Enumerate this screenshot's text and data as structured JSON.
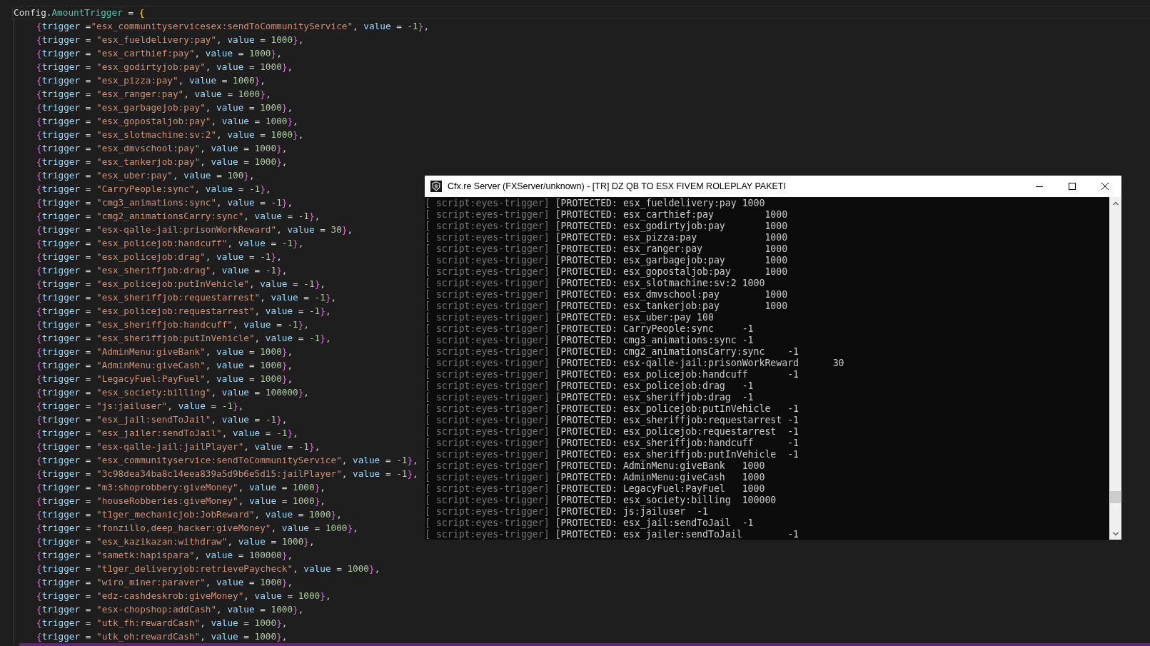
{
  "editor": {
    "header": "Config.AmountTrigger = {",
    "entries": [
      "{trigger =\"esx_communityservicesex:sendToCommunityService\", value = -1},",
      "{trigger = \"esx_fueldelivery:pay\", value = 1000},",
      "{trigger = \"esx_carthief:pay\", value = 1000},",
      "{trigger = \"esx_godirtyjob:pay\", value = 1000},",
      "{trigger = \"esx_pizza:pay\", value = 1000},",
      "{trigger = \"esx_ranger:pay\", value = 1000},",
      "{trigger = \"esx_garbagejob:pay\", value = 1000},",
      "{trigger = \"esx_gopostaljob:pay\", value = 1000},",
      "{trigger = \"esx_slotmachine:sv:2\", value = 1000},",
      "{trigger = \"esx_dmvschool:pay\", value = 1000},",
      "{trigger = \"esx_tankerjob:pay\", value = 1000},",
      "{trigger = \"esx_uber:pay\", value = 100},",
      "{trigger = \"CarryPeople:sync\", value = -1},",
      "{trigger = \"cmg3_animations:sync\", value = -1},",
      "{trigger = \"cmg2_animationsCarry:sync\", value = -1},",
      "{trigger = \"esx-qalle-jail:prisonWorkReward\", value = 30},",
      "{trigger = \"esx_policejob:handcuff\", value = -1},",
      "{trigger = \"esx_policejob:drag\", value = -1},",
      "{trigger = \"esx_sheriffjob:drag\", value = -1},",
      "{trigger = \"esx_policejob:putInVehicle\", value = -1},",
      "{trigger = \"esx_sheriffjob:requestarrest\", value = -1},",
      "{trigger = \"esx_policejob:requestarrest\", value = -1},",
      "{trigger = \"esx_sheriffjob:handcuff\", value = -1},",
      "{trigger = \"esx_sheriffjob:putInVehicle\", value = -1},",
      "{trigger = \"AdminMenu:giveBank\", value = 1000},",
      "{trigger = \"AdminMenu:giveCash\", value = 1000},",
      "{trigger = \"LegacyFuel:PayFuel\", value = 1000},",
      "{trigger = \"esx_society:billing\", value = 100000},",
      "{trigger = \"js:jailuser\", value = -1},",
      "{trigger = \"esx_jail:sendToJail\", value = -1},",
      "{trigger = \"esx_jailer:sendToJail\", value = -1},",
      "{trigger = \"esx-qalle-jail:jailPlayer\", value = -1},",
      "{trigger = \"esx_communityservice:sendToCommunityService\", value = -1},",
      "{trigger = \"3c98dea34ba8c14eea839a5d9b6e5d15:jailPlayer\", value = -1},",
      "{trigger = \"m3:shoprobbery:giveMoney\", value = 1000},",
      "{trigger = \"houseRobberies:giveMoney\", value = 1000},",
      "{trigger = \"t1ger_mechanicjob:JobReward\", value = 1000},",
      "{trigger = \"fonzillo,deep_hacker:giveMoney\", value = 1000},",
      "{trigger = \"esx_kazikazan:withdraw\", value = 1000},",
      "{trigger = \"sametk:hapispara\", value = 100000},",
      "{trigger = \"t1ger_deliveryjob:retrievePaycheck\", value = 1000},",
      "{trigger = \"wiro_miner:paraver\", value = 1000},",
      "{trigger = \"edz-cashdeskrob:giveMoney\", value = 1000},",
      "{trigger = \"esx-chopshop:addCash\", value = 1000},",
      "{trigger = \"utk_fh:rewardCash\", value = 1000},",
      "{trigger = \"utk_oh:rewardCash\", value = 1000},"
    ]
  },
  "console": {
    "title": "Cfx.re Server (FXServer/unknown) - [TR] DZ QB TO ESX FIVEM ROLEPLAY PAKETI",
    "lines": [
      {
        "source": "[ script:eyes-trigger]",
        "message": "[PROTECTED: esx_fueldelivery:pay 1000"
      },
      {
        "source": "[ script:eyes-trigger]",
        "message": "[PROTECTED: esx_carthief:pay         1000"
      },
      {
        "source": "[ script:eyes-trigger]",
        "message": "[PROTECTED: esx_godirtyjob:pay       1000"
      },
      {
        "source": "[ script:eyes-trigger]",
        "message": "[PROTECTED: esx_pizza:pay            1000"
      },
      {
        "source": "[ script:eyes-trigger]",
        "message": "[PROTECTED: esx_ranger:pay           1000"
      },
      {
        "source": "[ script:eyes-trigger]",
        "message": "[PROTECTED: esx_garbagejob:pay       1000"
      },
      {
        "source": "[ script:eyes-trigger]",
        "message": "[PROTECTED: esx_gopostaljob:pay      1000"
      },
      {
        "source": "[ script:eyes-trigger]",
        "message": "[PROTECTED: esx_slotmachine:sv:2 1000"
      },
      {
        "source": "[ script:eyes-trigger]",
        "message": "[PROTECTED: esx_dmvschool:pay        1000"
      },
      {
        "source": "[ script:eyes-trigger]",
        "message": "[PROTECTED: esx_tankerjob:pay        1000"
      },
      {
        "source": "[ script:eyes-trigger]",
        "message": "[PROTECTED: esx_uber:pay 100"
      },
      {
        "source": "[ script:eyes-trigger]",
        "message": "[PROTECTED: CarryPeople:sync     -1"
      },
      {
        "source": "[ script:eyes-trigger]",
        "message": "[PROTECTED: cmg3_animations:sync -1"
      },
      {
        "source": "[ script:eyes-trigger]",
        "message": "[PROTECTED: cmg2_animationsCarry:sync    -1"
      },
      {
        "source": "[ script:eyes-trigger]",
        "message": "[PROTECTED: esx-qalle-jail:prisonWorkReward      30"
      },
      {
        "source": "[ script:eyes-trigger]",
        "message": "[PROTECTED: esx_policejob:handcuff       -1"
      },
      {
        "source": "[ script:eyes-trigger]",
        "message": "[PROTECTED: esx_policejob:drag   -1"
      },
      {
        "source": "[ script:eyes-trigger]",
        "message": "[PROTECTED: esx_sheriffjob:drag  -1"
      },
      {
        "source": "[ script:eyes-trigger]",
        "message": "[PROTECTED: esx_policejob:putInVehicle   -1"
      },
      {
        "source": "[ script:eyes-trigger]",
        "message": "[PROTECTED: esx_sheriffjob:requestarrest -1"
      },
      {
        "source": "[ script:eyes-trigger]",
        "message": "[PROTECTED: esx_policejob:requestarrest  -1"
      },
      {
        "source": "[ script:eyes-trigger]",
        "message": "[PROTECTED: esx_sheriffjob:handcuff      -1"
      },
      {
        "source": "[ script:eyes-trigger]",
        "message": "[PROTECTED: esx_sheriffjob:putInVehicle  -1"
      },
      {
        "source": "[ script:eyes-trigger]",
        "message": "[PROTECTED: AdminMenu:giveBank   1000"
      },
      {
        "source": "[ script:eyes-trigger]",
        "message": "[PROTECTED: AdminMenu:giveCash   1000"
      },
      {
        "source": "[ script:eyes-trigger]",
        "message": "[PROTECTED: LegacyFuel:PayFuel   1000"
      },
      {
        "source": "[ script:eyes-trigger]",
        "message": "[PROTECTED: esx_society:billing  100000"
      },
      {
        "source": "[ script:eyes-trigger]",
        "message": "[PROTECTED: js:jailuser  -1"
      },
      {
        "source": "[ script:eyes-trigger]",
        "message": "[PROTECTED: esx_jail:sendToJail  -1"
      },
      {
        "source": "[ script:eyes-trigger]",
        "message": "[PROTECTED: esx_jailer:sendToJail        -1"
      }
    ]
  }
}
